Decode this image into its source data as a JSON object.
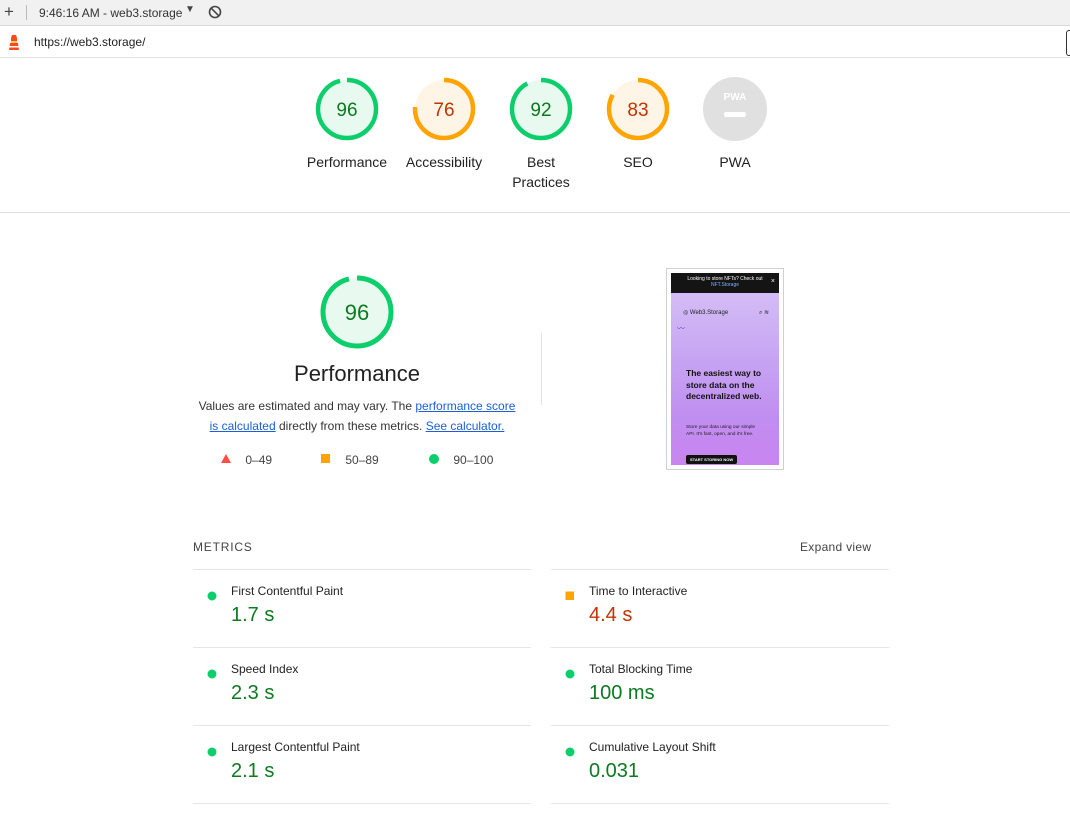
{
  "toolbar": {
    "add_icon": "plus-icon",
    "report_label": "9:46:16 AM - web3.storage",
    "dropdown_icon": "caret-down-icon",
    "clear_icon": "block-icon"
  },
  "address": {
    "icon": "lighthouse-icon",
    "url": "https://web3.storage/"
  },
  "colors": {
    "pass": "#0cce6b",
    "average": "#ffa400",
    "fail": "#ff4e42",
    "pass_text": "#0c7a1f",
    "average_text": "#c33300",
    "na": "#e0e0e0"
  },
  "categories": [
    {
      "label": "Performance",
      "score": "96",
      "score_value": 96,
      "rating": "pass"
    },
    {
      "label": "Accessibility",
      "score": "76",
      "score_value": 76,
      "rating": "average"
    },
    {
      "label": "Best Practices",
      "score": "92",
      "score_value": 92,
      "rating": "pass"
    },
    {
      "label": "SEO",
      "score": "83",
      "score_value": 83,
      "rating": "average"
    },
    {
      "label": "PWA",
      "score": "PWA",
      "rating": "na"
    }
  ],
  "performance": {
    "score": "96",
    "score_value": 96,
    "title": "Performance",
    "desc_prefix": "Values are estimated and may vary. The ",
    "desc_link1": "performance score is calculated",
    "desc_middle": " directly from these metrics. ",
    "desc_link2": "See calculator.",
    "legend": {
      "fail": "0–49",
      "average": "50–89",
      "pass": "90–100"
    }
  },
  "screenshot": {
    "banner_text": "Looking to store NFTs? Check out",
    "banner_link": "NFT.Storage",
    "close": "×",
    "logo": "Web3.Storage",
    "headline": "The easiest way to store data on the decentralized web.",
    "sub": "Store your data using our simple API. It's fast, open, and it's free.",
    "cta": "START STORING NOW"
  },
  "metrics": {
    "header": "METRICS",
    "expand": "Expand view",
    "items": [
      {
        "title": "First Contentful Paint",
        "value": "1.7 s",
        "rating": "pass"
      },
      {
        "title": "Time to Interactive",
        "value": "4.4 s",
        "rating": "average"
      },
      {
        "title": "Speed Index",
        "value": "2.3 s",
        "rating": "pass"
      },
      {
        "title": "Total Blocking Time",
        "value": "100 ms",
        "rating": "pass"
      },
      {
        "title": "Largest Contentful Paint",
        "value": "2.1 s",
        "rating": "pass"
      },
      {
        "title": "Cumulative Layout Shift",
        "value": "0.031",
        "rating": "pass"
      }
    ]
  }
}
